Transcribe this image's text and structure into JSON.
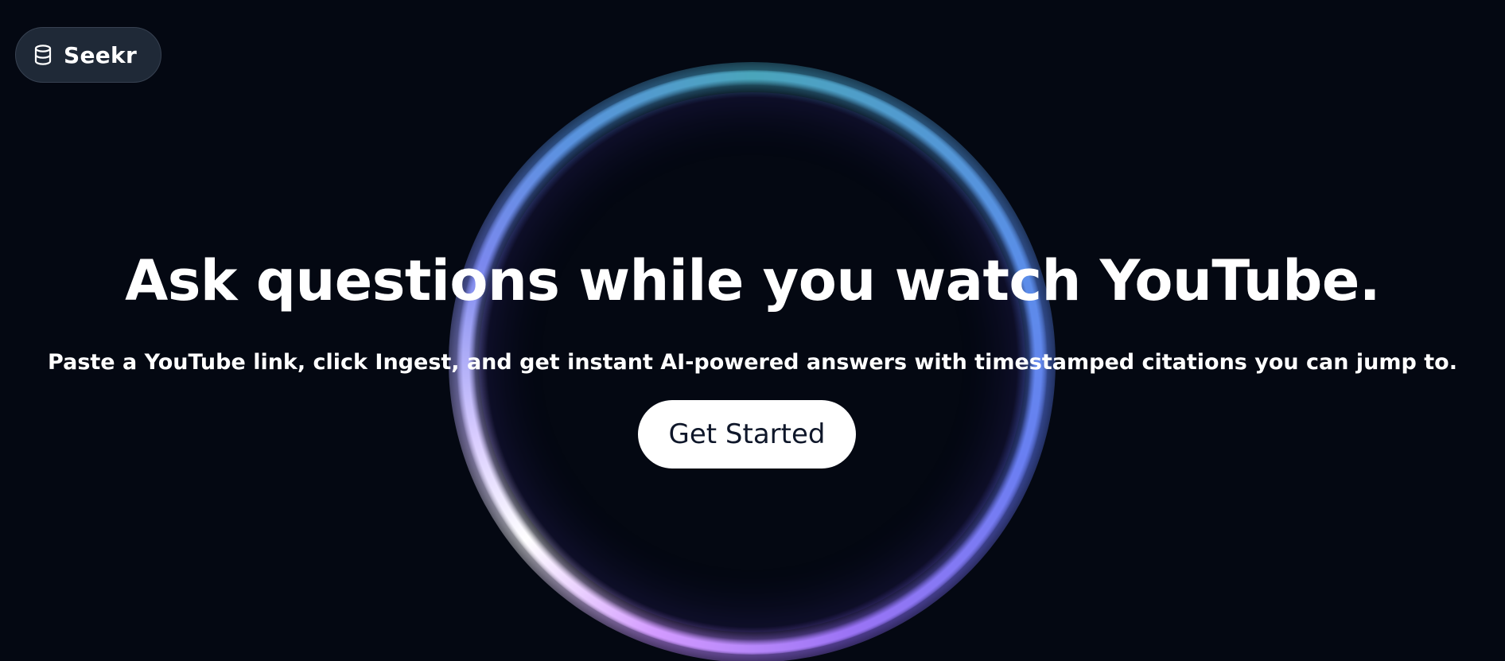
{
  "brand": {
    "name": "Seekr",
    "icon": "database-icon"
  },
  "hero": {
    "title": "Ask questions while you watch YouTube.",
    "subtitle": "Paste a YouTube link, click Ingest, and get instant AI-powered answers with timestamped citations you can jump to.",
    "cta_label": "Get Started"
  },
  "colors": {
    "background": "#040812",
    "brand_pill": "#1f2937",
    "text": "#ffffff",
    "button_bg": "#ffffff",
    "button_text": "#0f172a",
    "ring_teal": "#4aa5bb",
    "ring_blue": "#5a8ee8",
    "ring_purple": "#9b73f5",
    "ring_highlight": "#ffffff"
  }
}
